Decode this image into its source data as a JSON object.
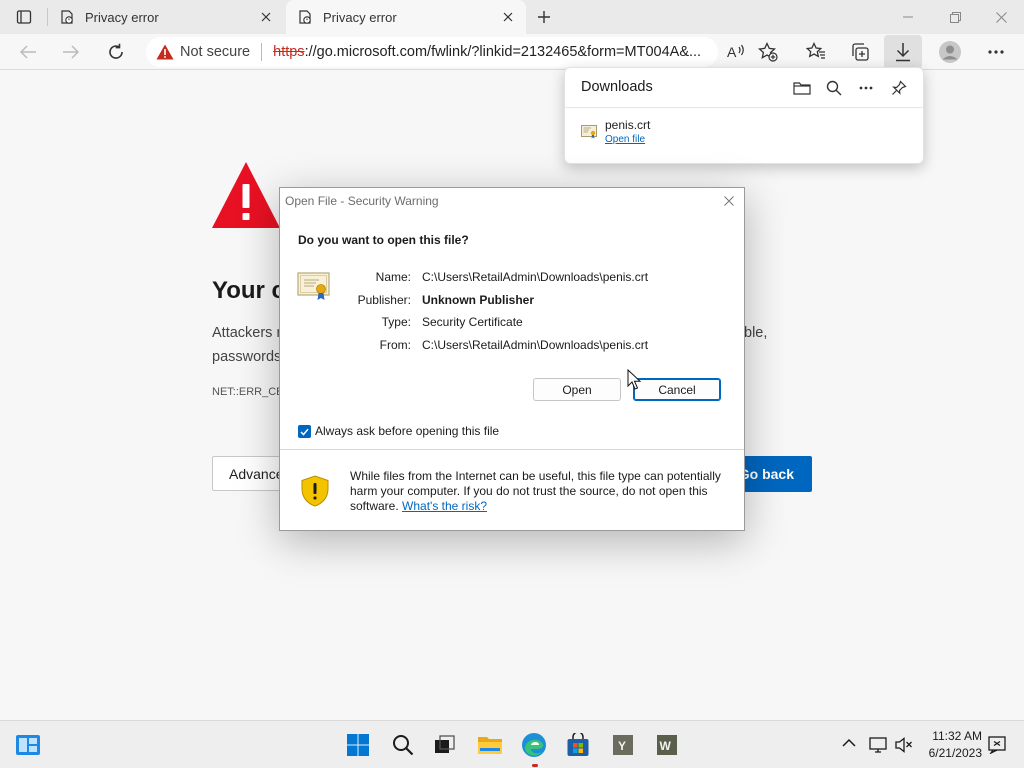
{
  "browser": {
    "tabs": [
      {
        "title": "Privacy error",
        "active": false
      },
      {
        "title": "Privacy error",
        "active": true
      }
    ],
    "address": {
      "security_label": "Not secure",
      "scheme": "https",
      "rest": "://go.microsoft.com/fwlink/?linkid=2132465&form=MT004A&..."
    }
  },
  "page": {
    "heading": "Your c",
    "body_line1_start": "Attackers m",
    "body_line1_end": "ble,",
    "body_line2": "passwords,",
    "error_code": "NET::ERR_CE",
    "advanced_label": "Advance",
    "goback_label": "Go back"
  },
  "downloads": {
    "title": "Downloads",
    "items": [
      {
        "filename": "penis.crt",
        "action": "Open file"
      }
    ]
  },
  "dialog": {
    "title": "Open File - Security Warning",
    "question": "Do you want to open this file?",
    "fields": {
      "name_label": "Name:",
      "name_value": "C:\\Users\\RetailAdmin\\Downloads\\penis.crt",
      "publisher_label": "Publisher:",
      "publisher_value": "Unknown Publisher",
      "type_label": "Type:",
      "type_value": "Security Certificate",
      "from_label": "From:",
      "from_value": "C:\\Users\\RetailAdmin\\Downloads\\penis.crt"
    },
    "open_label": "Open",
    "cancel_label": "Cancel",
    "checkbox_label": "Always ask before opening this file",
    "checkbox_checked": true,
    "warning_text": "While files from the Internet can be useful, this file type can potentially harm your computer. If you do not trust the source, do not open this software.",
    "risk_link": "What's the risk?"
  },
  "taskbar": {
    "time": "11:32 AM",
    "date": "6/21/2023"
  },
  "colors": {
    "accent": "#0067c0",
    "danger": "#e81123",
    "shield": "#f4c300"
  }
}
